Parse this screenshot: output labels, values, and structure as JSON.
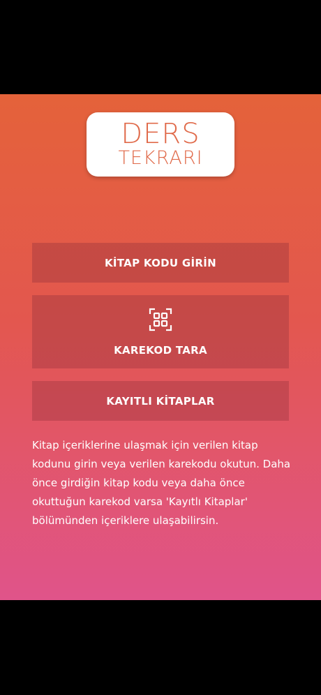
{
  "logo": {
    "line1": "DERS",
    "line2": "TEKRARI"
  },
  "buttons": {
    "enter_code": "KİTAP KODU GİRİN",
    "scan_qr": "KAREKOD TARA",
    "saved_books": "KAYITLI KİTAPLAR"
  },
  "icons": {
    "scan_qr": "qr-scan-icon"
  },
  "info_text": "Kitap içeriklerine ulaşmak için verilen kitap kodunu girin veya verilen karekodu okutun. Daha önce girdiğin kitap kodu veya daha önce okuttuğun karekod varsa 'Kayıtlı Kitaplar' bölümünden içeriklere ulaşabilirsin.",
  "colors": {
    "gradient_top": "#e4623a",
    "gradient_bottom": "#e0548a",
    "logo_text": "#e06a4a"
  }
}
